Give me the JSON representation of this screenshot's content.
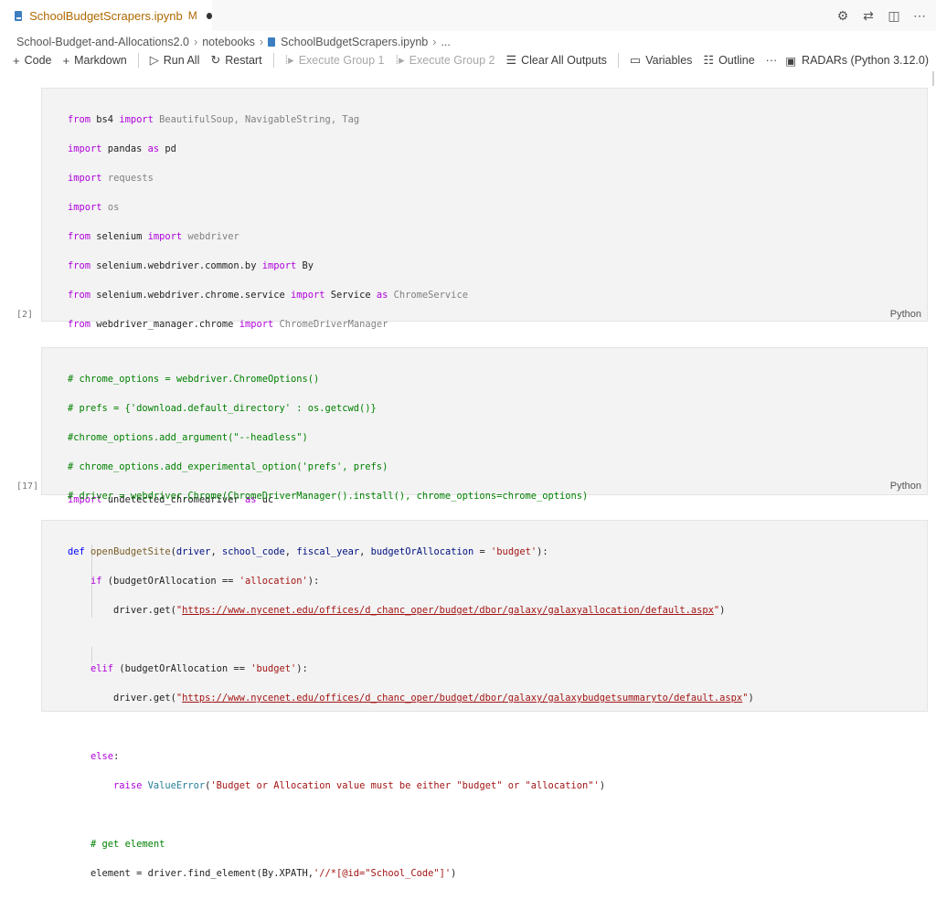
{
  "tab": {
    "filename": "SchoolBudgetScrapers.ipynb",
    "status": "M"
  },
  "breadcrumb": {
    "root": "School-Budget-and-Allocations2.0",
    "folder": "notebooks",
    "file": "SchoolBudgetScrapers.ipynb",
    "more": "..."
  },
  "toolbar": {
    "code_label": "Code",
    "markdown_label": "Markdown",
    "run_all_label": "Run All",
    "restart_label": "Restart",
    "exec_group1_label": "Execute Group 1",
    "exec_group2_label": "Execute Group 2",
    "clear_outputs_label": "Clear All Outputs",
    "variables_label": "Variables",
    "outline_label": "Outline",
    "more_label": "···",
    "kernel_label": "RADARs (Python 3.12.0)"
  },
  "cells": [
    {
      "execution_count": "[2]",
      "language": "Python"
    },
    {
      "execution_count": "[17]",
      "language": "Python"
    },
    {
      "execution_count": "",
      "language": ""
    }
  ],
  "icons": [
    "file-icon",
    "gear-icon",
    "compare-icon",
    "split-editor-icon",
    "more-icon",
    "plus-icon",
    "run-all-icon",
    "restart-icon",
    "execute-group-icon",
    "clear-outputs-icon",
    "variables-icon",
    "outline-icon",
    "kernel-icon"
  ]
}
